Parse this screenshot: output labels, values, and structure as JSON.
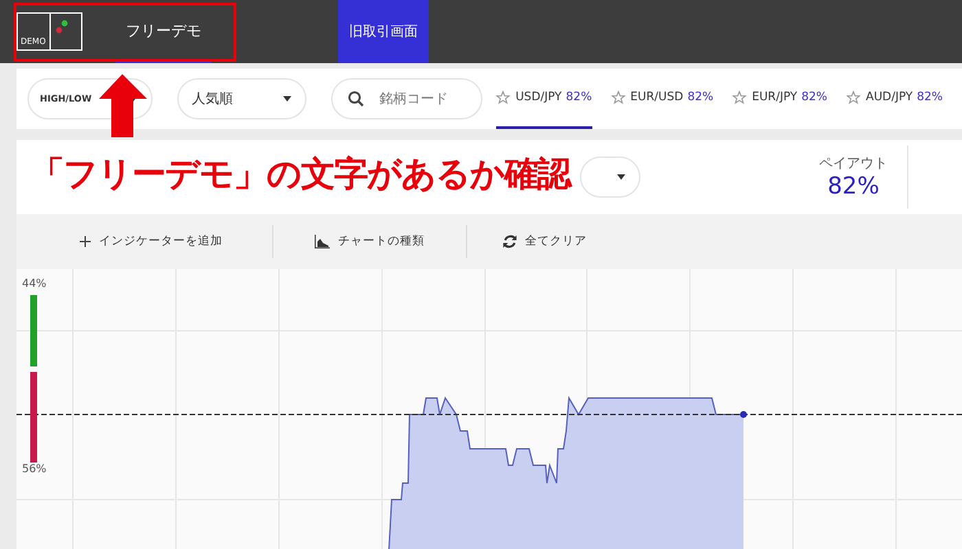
{
  "top_bar": {
    "logo_label": "DEMO",
    "tabs": [
      {
        "label": "フリーデモ",
        "selected": true
      }
    ],
    "legacy_button": "旧取引画面"
  },
  "filters": {
    "type_select": "HIGH/LOW",
    "sort_select": "人気順",
    "search": {
      "placeholder": "銘柄コード"
    }
  },
  "asset_tabs": [
    {
      "name": "USD/JPY",
      "payout": "82%",
      "selected": true
    },
    {
      "name": "EUR/USD",
      "payout": "82%",
      "selected": false
    },
    {
      "name": "EUR/JPY",
      "payout": "82%",
      "selected": false
    },
    {
      "name": "AUD/JPY",
      "payout": "82%",
      "selected": false
    }
  ],
  "asset": {
    "payout_label": "ペイアウト",
    "payout": "82%"
  },
  "toolbar": [
    {
      "kind": "add",
      "label": "インジケーターを追加"
    },
    {
      "kind": "chart",
      "label": "チャートの種類"
    },
    {
      "kind": "clear",
      "label": "全てクリア"
    }
  ],
  "sentiment": {
    "up_label": "44%",
    "down_label": "56%",
    "level": 0.44
  },
  "annotation": {
    "caption": "「フリーデモ」の文字があるか確認"
  }
}
